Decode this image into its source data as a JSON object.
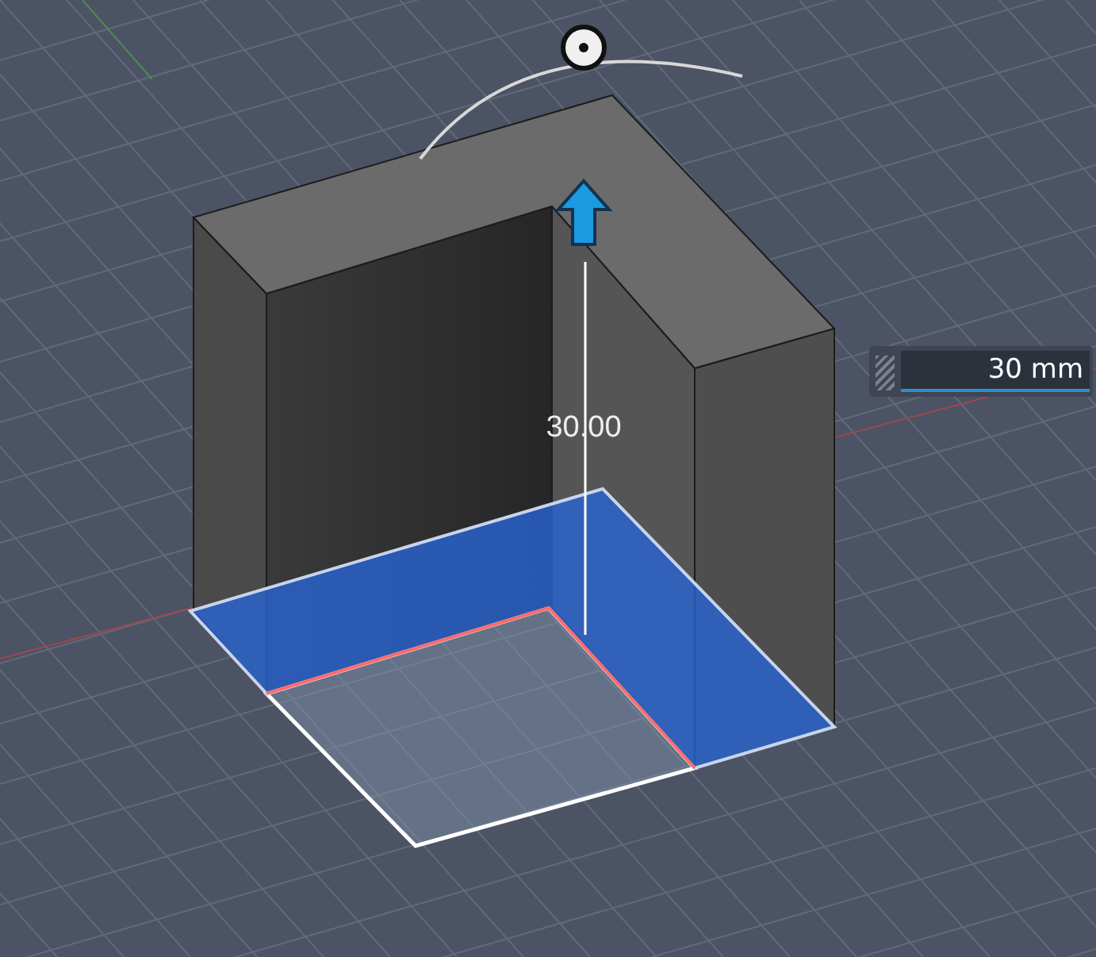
{
  "dimension_label": "30.00",
  "distance_input": {
    "value": "30 mm"
  }
}
